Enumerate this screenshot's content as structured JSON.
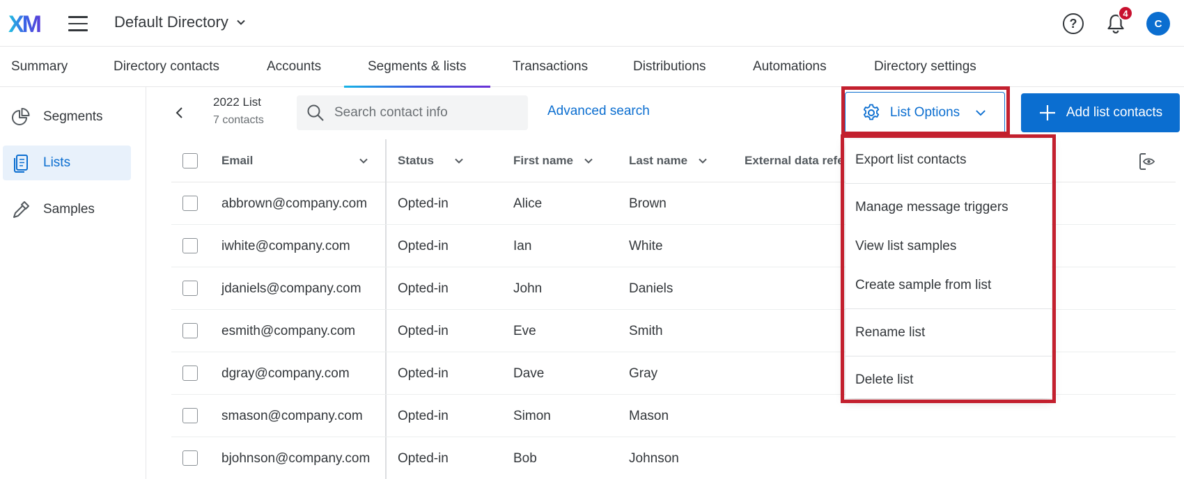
{
  "header": {
    "logo_text": "XM",
    "directory_title": "Default Directory",
    "help_label": "?",
    "notification_count": "4",
    "avatar_initial": "C"
  },
  "tabs": [
    {
      "label": "Summary"
    },
    {
      "label": "Directory contacts"
    },
    {
      "label": "Accounts"
    },
    {
      "label": "Segments & lists",
      "active": true
    },
    {
      "label": "Transactions"
    },
    {
      "label": "Distributions"
    },
    {
      "label": "Automations"
    },
    {
      "label": "Directory settings"
    }
  ],
  "sidebar": {
    "items": [
      {
        "label": "Segments",
        "icon": "pie-chart-icon"
      },
      {
        "label": "Lists",
        "icon": "list-pages-icon",
        "active": true
      },
      {
        "label": "Samples",
        "icon": "pipette-icon"
      }
    ]
  },
  "list": {
    "name": "2022 List",
    "count": "7 contacts"
  },
  "search": {
    "placeholder": "Search contact info",
    "value": ""
  },
  "toolbar": {
    "advanced_search": "Advanced search",
    "list_options": "List Options",
    "add_contacts": "Add list contacts"
  },
  "table": {
    "columns": [
      "Email",
      "Status",
      "First name",
      "Last name",
      "External data refe"
    ],
    "rows": [
      {
        "email": "abbrown@company.com",
        "status": "Opted-in",
        "first": "Alice",
        "last": "Brown"
      },
      {
        "email": "iwhite@company.com",
        "status": "Opted-in",
        "first": "Ian",
        "last": "White"
      },
      {
        "email": "jdaniels@company.com",
        "status": "Opted-in",
        "first": "John",
        "last": "Daniels"
      },
      {
        "email": "esmith@company.com",
        "status": "Opted-in",
        "first": "Eve",
        "last": "Smith"
      },
      {
        "email": "dgray@company.com",
        "status": "Opted-in",
        "first": "Dave",
        "last": "Gray"
      },
      {
        "email": "smason@company.com",
        "status": "Opted-in",
        "first": "Simon",
        "last": "Mason"
      },
      {
        "email": "bjohnson@company.com",
        "status": "Opted-in",
        "first": "Bob",
        "last": "Johnson"
      }
    ]
  },
  "menu": {
    "items": [
      "Export list contacts",
      "Manage message triggers",
      "View list samples",
      "Create sample from list",
      "Rename list",
      "Delete list"
    ]
  },
  "colors": {
    "accent": "#0b6ed0",
    "highlight": "#c3202e",
    "badge": "#c8102e"
  }
}
